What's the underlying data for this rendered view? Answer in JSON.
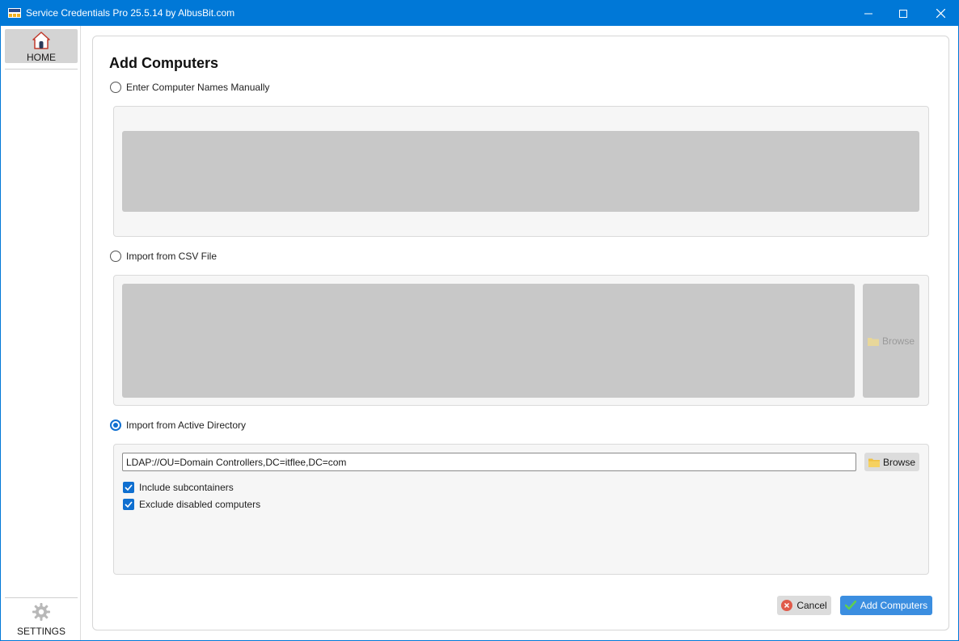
{
  "window": {
    "title": "Service Credentials Pro 25.5.14 by AlbusBit.com"
  },
  "sidebar": {
    "home_label": "HOME",
    "settings_label": "SETTINGS"
  },
  "main": {
    "heading": "Add Computers",
    "options": {
      "manual_label": "Enter Computer Names Manually",
      "csv_label": "Import from CSV File",
      "ad_label": "Import from Active Directory"
    },
    "selected_option": "Import from Active Directory",
    "csv": {
      "browse_label": "Browse"
    },
    "ad": {
      "ldap_path": "LDAP://OU=Domain Controllers,DC=itflee,DC=com",
      "browse_label": "Browse",
      "include_subcontainers_label": "Include subcontainers",
      "include_subcontainers_checked": true,
      "exclude_disabled_label": "Exclude disabled computers",
      "exclude_disabled_checked": true
    },
    "footer": {
      "cancel_label": "Cancel",
      "add_label": "Add Computers"
    }
  },
  "colors": {
    "titlebar": "#0078d7",
    "accent": "#0f6fd0",
    "primary_button": "#3b8ee0",
    "disabled_field": "#c8c8c8",
    "cancel_icon": "#e05a4a",
    "check_icon": "#4caf50",
    "folder_icon": "#f0c040"
  },
  "icons": {
    "app": "service-credentials-icon",
    "home": "house-icon",
    "settings": "gear-icon",
    "browse": "folder-icon",
    "cancel": "cancel-x-icon",
    "add": "checkmark-icon"
  }
}
